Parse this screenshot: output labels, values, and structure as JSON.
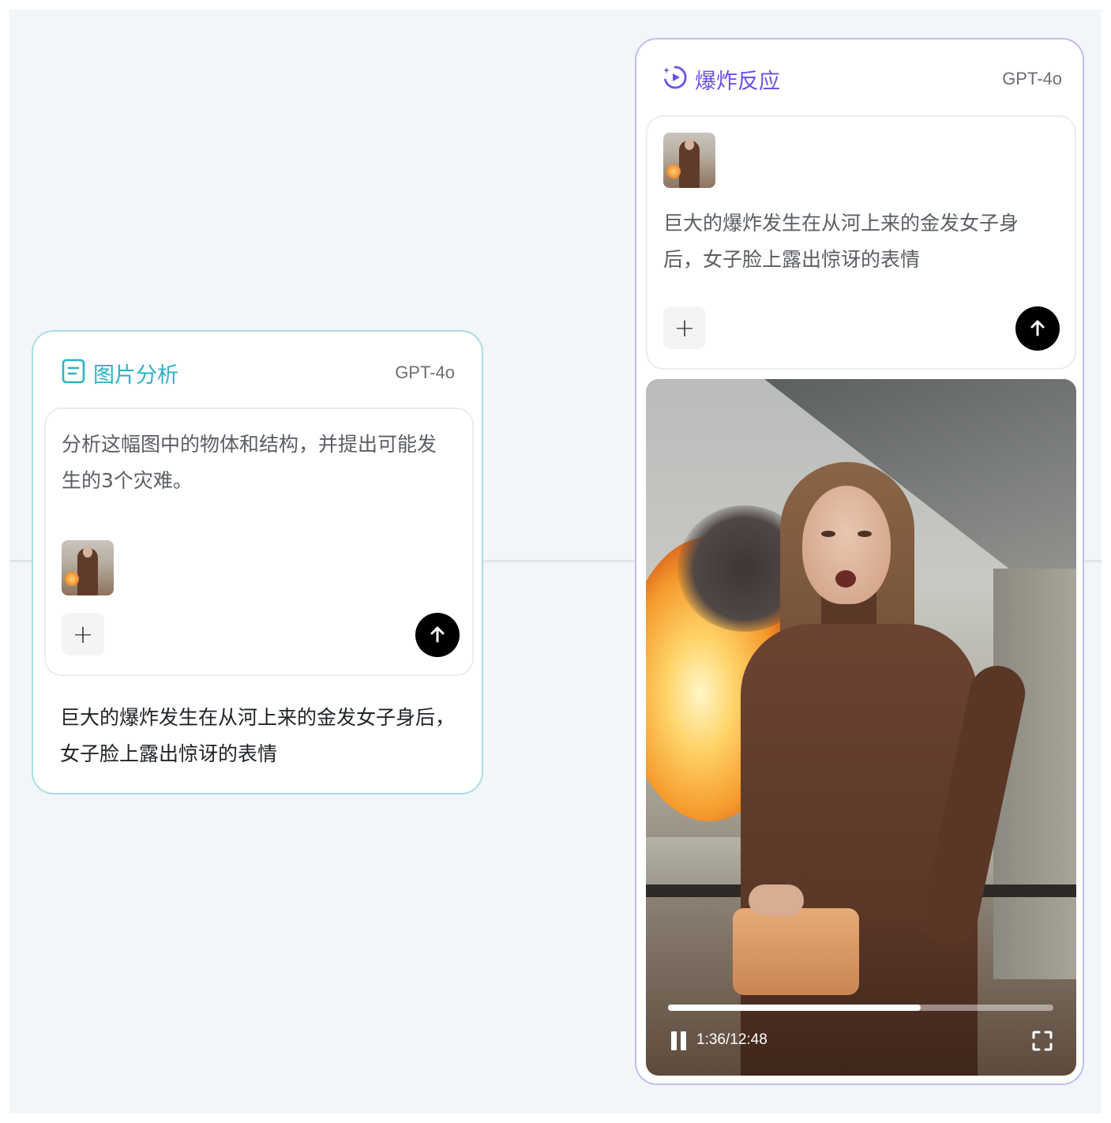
{
  "left_node": {
    "title": "图片分析",
    "title_icon": "document-icon",
    "model": "GPT-4o",
    "prompt": "分析这幅图中的物体和结构，并提出可能发生的3个灾难。",
    "output": "巨大的爆炸发生在从河上来的金发女子身后，女子脸上露出惊讶的表情",
    "accent_color": "#2bb3c8"
  },
  "right_node": {
    "title": "爆炸反应",
    "title_icon": "video-sparkle-icon",
    "model": "GPT-4o",
    "prompt": "巨大的爆炸发生在从河上来的金发女子身后，女子脸上露出惊讶的表情",
    "accent_color": "#6b52e6",
    "video": {
      "time": "1:36/12:48",
      "progress": 0.655,
      "state": "playing"
    }
  }
}
